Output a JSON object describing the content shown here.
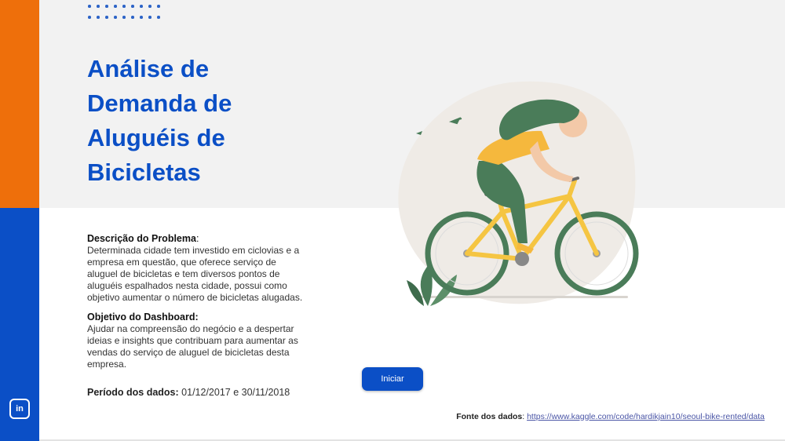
{
  "header": {
    "title_lines": [
      "Análise de",
      "Demanda de",
      "Aluguéis de",
      "Bicicletas"
    ]
  },
  "problem": {
    "heading": "Descrição do Problema",
    "colon": ":",
    "text": "Determinada cidade tem investido em ciclovias e a empresa em questão, que oferece serviço de aluguel de bicicletas e tem diversos pontos de aluguéis espalhados nesta cidade, possui como objetivo aumentar o número de bicicletas alugadas."
  },
  "objective": {
    "heading": "Objetivo do Dashboard:",
    "text": "Ajudar na compreensão do negócio e a despertar ideias e insights que contribuam para aumentar as vendas do serviço de aluguel de bicicletas desta empresa."
  },
  "period": {
    "label": "Período dos dados:",
    "value": "01/12/2017 e 30/11/2018"
  },
  "start_button": {
    "label": "Iniciar"
  },
  "source": {
    "label": "Fonte dos dados",
    "colon": ":",
    "url": "https://www.kaggle.com/code/hardikjain10/seoul-bike-rented/data"
  },
  "sidebar": {
    "linkedin_text": "in"
  },
  "colors": {
    "orange": "#ee6f0b",
    "blue": "#0b4fc6",
    "gray_band": "#f2f2f2",
    "bike_frame": "#f5c542",
    "green": "#4a7c59"
  }
}
